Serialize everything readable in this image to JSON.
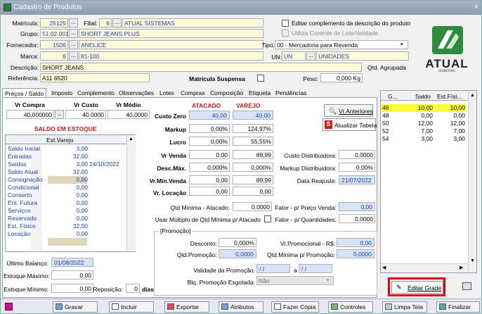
{
  "window": {
    "title": "Cadastro de Produtos",
    "close": "×"
  },
  "header": {
    "matricula_label": "Matrícula:",
    "matricula": "25125",
    "filial_label": "Filial:",
    "filial_code": "6",
    "filial_name": "ATUAL SISTEMAS",
    "grupo_label": "Grupo:",
    "grupo_code": "51.02.001",
    "grupo_name": "SHORT JEANS PLUS",
    "fornecedor_label": "Fornecedor:",
    "fornecedor_code": "1506",
    "fornecedor_name": "ANELICE",
    "marca_label": "Marca:",
    "marca_code": "8",
    "marca_name": "81-100",
    "descricao_label": "Descrição:",
    "descricao": "SHORT JEANS",
    "referencia_label": "Referência:",
    "referencia": "A11 6520",
    "editar_compl": "Editar complemento da descrição do produto",
    "controle_lote": "Utiliza Controle de Lote/Validade",
    "tipo_label": "Tipo:",
    "tipo": "00 - Mercadoria para Revenda",
    "un_label": "UN:",
    "un_code": "UN",
    "un_name": "UNIDADES",
    "qtd_agrupada": "Qtd. Agrupada",
    "matricula_suspensa": "Matrícula Suspensa",
    "peso_label": "Peso:",
    "peso": "0,000 Kg",
    "logo": "ATUAL",
    "logo_sub": "sistemas"
  },
  "tabs": [
    "Preços / Saldo",
    "Imposto",
    "Complemento",
    "Observações",
    "Lotes",
    "Compras",
    "Composição",
    "Etiqueta",
    "Pendências"
  ],
  "precos": {
    "vr_compra_label": "Vr Compra",
    "vr_custo_label": "Vr Custo",
    "vr_medio_label": "Vr Médio",
    "vr_compra": "40,000000",
    "vr_custo": "40,0000",
    "vr_medio": "40,0000",
    "atacado": "ATACADO",
    "varejo": "VAREJO",
    "custo_zero_label": "Custo Zero",
    "custo_zero_atac": "40,00",
    "custo_zero_var": "40,00",
    "markup_label": "Markup",
    "markup_atac": "0,00%",
    "markup_var": "124,97%",
    "lucro_label": "Lucro",
    "lucro_atac": "0,00%",
    "lucro_var": "55,55%",
    "vr_venda_label": "Vr Venda",
    "vr_venda_atac": "0,00",
    "vr_venda_var": "89,99",
    "desc_max_label": "Desc.Máx.",
    "desc_max_atac": "0,000%",
    "desc_max_var": "0,000%",
    "vr_min_venda_label": "Vr.Mín.Venda",
    "vr_min_venda_atac": "0,00",
    "vr_min_venda_var": "89,99",
    "vr_locacao_label": "Vr. Locação",
    "vr_locacao_atac": "0,00",
    "vr_locacao_var": "0,00",
    "vr_anteriores": "Vr.Anteriores",
    "atualizar_tabela": "Atualizar Tabela",
    "custo_distrib_label": "Custo Distribuidora:",
    "custo_distrib": "0,0000",
    "markup_distrib_label": "Markup Distribuidora:",
    "markup_distrib": "0,00%",
    "data_reajuste_label": "Data Reajuste:",
    "data_reajuste": "21/07/2022",
    "qtd_min_atac_label": "Qtd Mínima - Atacado:",
    "qtd_min_atac": "0,0000",
    "fator_preco_label": "Fator - p/ Preço Venda:",
    "fator_preco": "0,00",
    "usar_multiplo_label": "Usar Múltiplo de Qtd Mínima p/ Atacado",
    "fator_qtd_label": "Fator - p/ Quantidades:",
    "fator_qtd": "0,0000"
  },
  "promocao": {
    "legend": "[Promoção]",
    "desconto_label": "Desconto:",
    "desconto": "0,000%",
    "vr_promo_label": "Vr.Promocional - R$:",
    "vr_promo": "0,00",
    "qtd_promo_label": "Qtd.Promoção:",
    "qtd_promo": "0,0000",
    "qtd_min_promo_label": "Qtd.Mínima p/ Promoção:",
    "qtd_min_promo": "0,0000",
    "validade_label": "Validade da Promoção:",
    "validade_de": "/ /",
    "validade_a": "a",
    "validade_ate": "/ /",
    "blq_label": "Blq. Promoção Esgotada:",
    "blq": "Não"
  },
  "saldo": {
    "title": "SALDO EM ESTOQUE",
    "col": "Est.Varejo",
    "rows": [
      {
        "name": "Saldo Inicial",
        "value": "3,00",
        "date": ""
      },
      {
        "name": "Entradas",
        "value": "32,00",
        "date": ""
      },
      {
        "name": "Saídas",
        "value": "3,00",
        "date": "24/10/2022"
      },
      {
        "name": "Saldo Atual",
        "value": "32,00",
        "date": ""
      },
      {
        "name": "Consignação",
        "value": "0,00",
        "date": ""
      },
      {
        "name": "Condicional",
        "value": "0,00",
        "date": ""
      },
      {
        "name": "Conserto",
        "value": "0,00",
        "date": ""
      },
      {
        "name": "Ent. Futura",
        "value": "0,00",
        "date": ""
      },
      {
        "name": "Serviços",
        "value": "0,00",
        "date": ""
      },
      {
        "name": "Reservado",
        "value": "0,00",
        "date": ""
      },
      {
        "name": "Est. Físico",
        "value": "32,00",
        "date": ""
      },
      {
        "name": "Locação",
        "value": "0,00",
        "date": ""
      }
    ],
    "ultimo_balanco_label": "Último Balanço:",
    "ultimo_balanco": "01/08/2022",
    "est_max_label": "Estoque Máximo:",
    "est_max": "0,00",
    "est_min_label": "Estoque Mínimo:",
    "est_min": "0,00",
    "reposicao_label": "Reposição:",
    "reposicao": "0",
    "dias": "dias"
  },
  "grid": {
    "headers": [
      "G...",
      "Saldo",
      "Est.Físi..."
    ],
    "rows": [
      [
        "46",
        "10,00",
        "10,00"
      ],
      [
        "48",
        "0,00",
        "0,00"
      ],
      [
        "50",
        "12,00",
        "12,00"
      ],
      [
        "52",
        "7,00",
        "7,00"
      ],
      [
        "54",
        "3,00",
        "3,00"
      ]
    ],
    "editar_grade": "Editar Grade"
  },
  "toolbar": [
    "Gravar",
    "Incluir",
    "Exportar",
    "Atributos",
    "Fazer Cópia",
    "Controles",
    "Limpa Tela",
    "Finalizar"
  ],
  "colors": {
    "accent_red": "#e00000",
    "logo_green": "#2e8b3e"
  }
}
